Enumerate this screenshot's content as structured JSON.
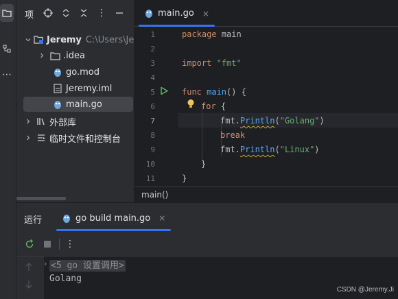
{
  "project_panel": {
    "title": "项",
    "root": {
      "name": "Jeremy",
      "path": "C:\\Users\\Jer"
    },
    "items": [
      {
        "label": ".idea",
        "icon": "folder-icon"
      },
      {
        "label": "go.mod",
        "icon": "gomod-file-icon"
      },
      {
        "label": "Jeremy.iml",
        "icon": "iml-file-icon"
      },
      {
        "label": "main.go",
        "icon": "go-file-icon"
      },
      {
        "label": "外部库",
        "icon": "library-icon"
      },
      {
        "label": "临时文件和控制台",
        "icon": "scratches-icon"
      }
    ]
  },
  "editor": {
    "tab": {
      "label": "main.go",
      "close": "×"
    },
    "line_numbers": [
      "1",
      "2",
      "3",
      "4",
      "5",
      "6",
      "7",
      "8",
      "9",
      "10",
      "11"
    ],
    "code": {
      "l1_kw": "package",
      "l1_name": " main",
      "l3_kw": "import",
      "l3_str": " \"fmt\"",
      "l5_kw": "func",
      "l5_fn": " main",
      "l5_rest": "() {",
      "l6_kw": "for",
      "l6_rest": " {",
      "l7_pkg": "fmt.",
      "l7_method": "Println",
      "l7_open": "(",
      "l7_str": "\"Golang\"",
      "l7_close": ")",
      "l8_kw": "break",
      "l9_pkg": "fmt.",
      "l9_method": "Println",
      "l9_open": "(",
      "l9_str": "\"Linux\"",
      "l9_close": ")",
      "l10": "}",
      "l11": "}"
    },
    "breadcrumb": "main()"
  },
  "run_panel": {
    "title": "运行",
    "tab": {
      "label": "go build main.go",
      "close": "×"
    },
    "console": {
      "folded": "<5 go 设置调用>",
      "output": "Golang"
    }
  },
  "watermark": "CSDN @Jeremy.Ji",
  "colors": {
    "accent": "#3574f0",
    "run_green": "#5fb865",
    "bulb": "#f2c55c"
  }
}
